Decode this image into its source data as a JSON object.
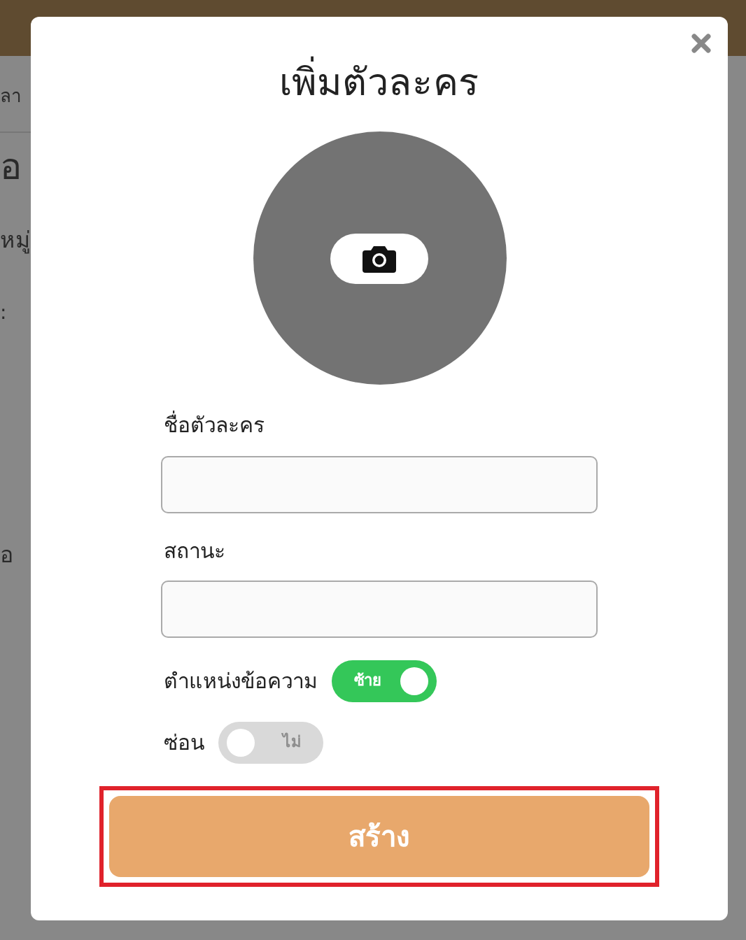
{
  "background": {
    "fragments": [
      "ลา",
      "อ",
      "หมู่",
      ":",
      "อ"
    ]
  },
  "dialog": {
    "title": "เพิ่มตัวละคร",
    "fields": [
      {
        "label": "ชื่อตัวละคร"
      },
      {
        "label": "สถานะ"
      }
    ],
    "toggles": [
      {
        "label": "ตำแหน่งข้อความ",
        "on": true,
        "text": "ซ้าย"
      },
      {
        "label": "ซ่อน",
        "on": false,
        "text": "ไม่"
      }
    ],
    "submit": {
      "label": "สร้าง",
      "highlighted": true
    }
  }
}
